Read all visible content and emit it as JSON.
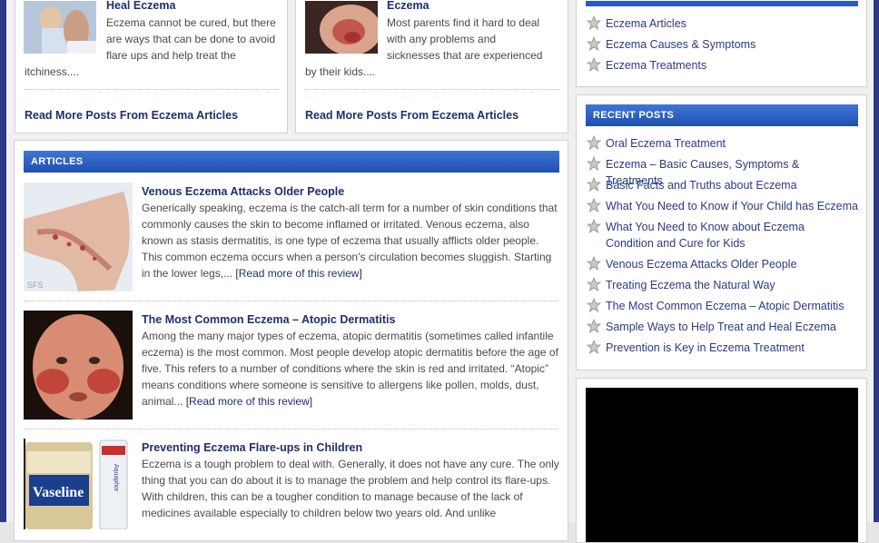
{
  "top_posts": [
    {
      "title": "Sample Ways to Help Treat and Heal Eczema",
      "title_visible_line": "Heal Eczema",
      "excerpt_lines": [
        "Eczema cannot be cured, but there",
        "are ways that can be done to avoid",
        "flare ups and help treat the"
      ],
      "excerpt_tail": "itchiness....",
      "read_more": "Read More Posts From Eczema Articles"
    },
    {
      "title": "Basic Facts and Truths about Eczema",
      "title_visible_line": "Eczema",
      "excerpt_lines": [
        "Most parents find it hard to deal",
        "with any problems and",
        "sicknesses that are experienced"
      ],
      "excerpt_tail": "by their kids....",
      "read_more": "Read More Posts From Eczema Articles"
    }
  ],
  "articles": {
    "header": "ARTICLES",
    "items": [
      {
        "title": "Venous Eczema Attacks Older People",
        "body": "Generically speaking, eczema is the catch-all term for a number of skin conditions that commonly causes the skin to become inflamed or irritated. Venous eczema, also known as stasis dermatitis, is one type of eczema that usually afflicts older people. This common eczema occurs when a person’s circulation becomes sluggish. Starting in the lower legs,...",
        "read_more": "[Read more of this review]"
      },
      {
        "title": "The Most Common Eczema – Atopic Dermatitis",
        "body": "Among the many major types of eczema, atopic dermatitis (sometimes called infantile eczema) is the most common. Most people develop atopic dermatitis before the age of five. This refers to a number of conditions where the skin is red and irritated. “Atopic” means conditions where someone is sensitive to allergens like pollen, molds, dust, animal...",
        "read_more": "[Read more of this review]"
      },
      {
        "title": "Preventing Eczema Flare-ups in Children",
        "body": "Eczema is a tough problem to deal with. Generally, it does not have any cure. The only thing that you can do about it is to manage the problem and help control its flare-ups. With children, this can be a tougher condition to manage because of the lack of medicines available especially to children below two years old. And unlike",
        "read_more": ""
      }
    ]
  },
  "categories": {
    "items": [
      "Eczema Articles",
      "Eczema Causes & Symptoms",
      "Eczema Treatments"
    ]
  },
  "recent_posts": {
    "header": "RECENT POSTS",
    "items": [
      "Oral Eczema Treatment",
      "Eczema – Basic Causes, Symptoms & Treatments",
      "Basic Facts and Truths about Eczema",
      "What You Need to Know if Your Child has Eczema",
      "What You Need to Know about Eczema Condition and Cure for Kids",
      "Venous Eczema Attacks Older People",
      "Treating Eczema the Natural Way",
      "The Most Common Eczema – Atopic Dermatitis",
      "Sample Ways to Help Treat and Heal Eczema",
      "Prevention is Key in Eczema Treatment"
    ]
  },
  "thumb_texts": {
    "leg_caption": "SFS",
    "vaseline_label": "Vaseline",
    "aquaphor_label": "Aquaphor"
  },
  "colors": {
    "frame": "#2a3a86",
    "bar": "#2f63c8",
    "link": "#1e2f6e"
  }
}
